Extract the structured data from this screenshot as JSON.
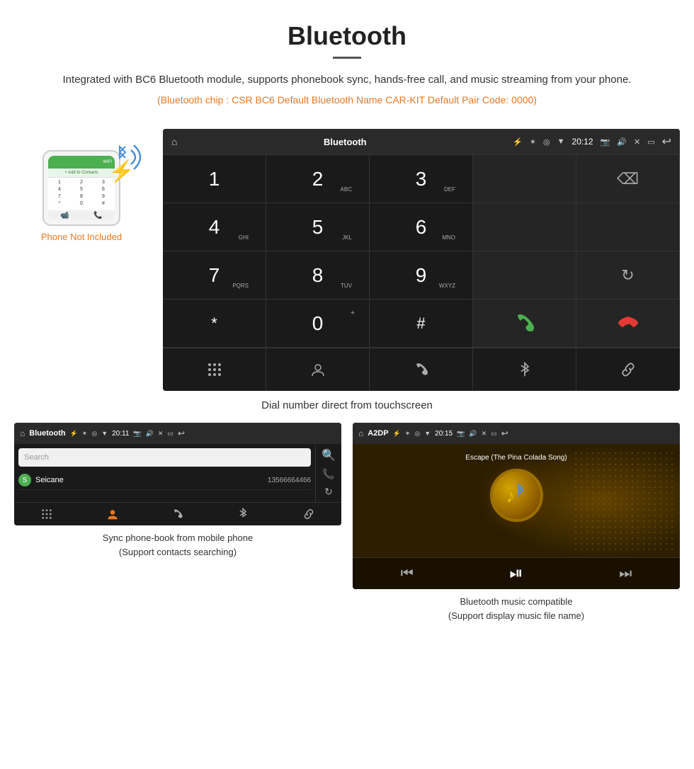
{
  "header": {
    "title": "Bluetooth",
    "description": "Integrated with BC6 Bluetooth module, supports phonebook sync, hands-free call, and music streaming from your phone.",
    "spec_line": "(Bluetooth chip : CSR BC6     Default Bluetooth Name CAR-KIT     Default Pair Code: 0000)"
  },
  "phone_label": "Phone Not Included",
  "main_caption": "Dial number direct from touchscreen",
  "car_screen_main": {
    "status_bar": {
      "title": "Bluetooth",
      "time": "20:12"
    },
    "keys": [
      {
        "num": "1",
        "sub": ""
      },
      {
        "num": "2",
        "sub": "ABC"
      },
      {
        "num": "3",
        "sub": "DEF"
      },
      {
        "num": "",
        "sub": ""
      },
      {
        "num": "⌫",
        "sub": ""
      },
      {
        "num": "4",
        "sub": "GHI"
      },
      {
        "num": "5",
        "sub": "JKL"
      },
      {
        "num": "6",
        "sub": "MNO"
      },
      {
        "num": "",
        "sub": ""
      },
      {
        "num": "",
        "sub": ""
      },
      {
        "num": "7",
        "sub": "PQRS"
      },
      {
        "num": "8",
        "sub": "TUV"
      },
      {
        "num": "9",
        "sub": "WXYZ"
      },
      {
        "num": "",
        "sub": ""
      },
      {
        "num": "↻",
        "sub": ""
      },
      {
        "num": "*",
        "sub": ""
      },
      {
        "num": "0",
        "sub": "+"
      },
      {
        "num": "#",
        "sub": ""
      },
      {
        "num": "📞",
        "sub": ""
      },
      {
        "num": "📵",
        "sub": ""
      }
    ],
    "action_bar": [
      "⋮⋮⋮",
      "👤",
      "📞",
      "✴",
      "🔗"
    ]
  },
  "phonebook_screen": {
    "status_bar": {
      "title": "Bluetooth",
      "time": "20:11"
    },
    "search_placeholder": "Search",
    "contacts": [
      {
        "letter": "S",
        "name": "Seicane",
        "number": "13566664466"
      }
    ],
    "bottom_icons": [
      "⋮⋮⋮",
      "👤",
      "📞",
      "✴",
      "🔗"
    ]
  },
  "music_screen": {
    "status_bar": {
      "title": "A2DP",
      "time": "20:15"
    },
    "song_title": "Escape (The Pina Colada Song)",
    "controls": [
      "⏮",
      "⏯",
      "⏭"
    ]
  },
  "bottom_captions": {
    "left": "Sync phone-book from mobile phone\n(Support contacts searching)",
    "right": "Bluetooth music compatible\n(Support display music file name)"
  }
}
